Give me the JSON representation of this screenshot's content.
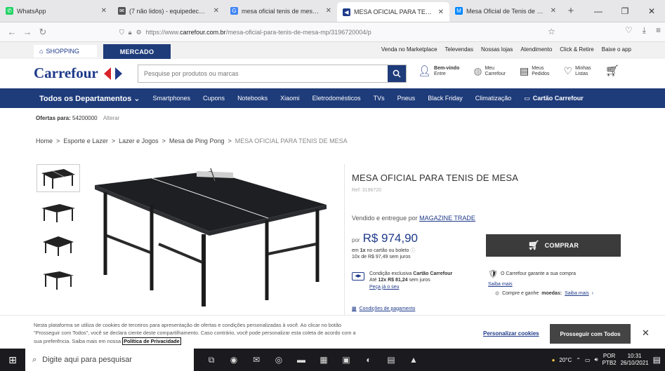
{
  "browser": {
    "tabs": [
      {
        "label": "WhatsApp",
        "favicon": "whatsapp-icon",
        "color": "#25d366"
      },
      {
        "label": "(7 não lidos) - equipedec@yah...",
        "favicon": "mail-icon",
        "color": "#555"
      },
      {
        "label": "mesa oficial tenis de mesa - Pe...",
        "favicon": "google-icon",
        "color": "#4285f4"
      },
      {
        "label": "MESA OFICIAL PARA TENIS DE ...",
        "favicon": "carrefour-icon",
        "color": "#1e3a8a"
      },
      {
        "label": "Mesa Oficial de Tenis de Mesa - ...",
        "favicon": "magalu-icon",
        "color": "#0086ff"
      }
    ],
    "url_prefix": "https://www.",
    "url_host": "carrefour.com.br",
    "url_path": "/mesa-oficial-para-tenis-de-mesa-mp/3196720004/p"
  },
  "header": {
    "shopping_tab": "SHOPPING",
    "mercado_tab": "MERCADO",
    "top_links": [
      "Venda no Marketplace",
      "Televendas",
      "Nossas lojas",
      "Atendimento",
      "Click & Retire",
      "Baixe o app"
    ],
    "logo": "Carrefour",
    "search_placeholder": "Pesquise por produtos ou marcas",
    "account_line1": "Bem-vindo",
    "account_line2": "Entre",
    "meu_line1": "Meu",
    "meu_line2": "Carrefour",
    "pedidos_line1": "Meus",
    "pedidos_line2": "Pedidos",
    "listas_line1": "Minhas",
    "listas_line2": "Listas"
  },
  "departments": {
    "first": "Todos os Departamentos",
    "items": [
      "Smartphones",
      "Cupons",
      "Notebooks",
      "Xiaomi",
      "Eletrodomésticos",
      "TVs",
      "Pneus",
      "Black Friday",
      "Climatização"
    ],
    "last": "Cartão Carrefour"
  },
  "ofertas": {
    "label": "Ofertas para:",
    "cep": "54200000",
    "alterar": "Alterar"
  },
  "breadcrumb": [
    "Home",
    "Esporte e Lazer",
    "Lazer e Jogos",
    "Mesa de Ping Pong",
    "MESA OFICIAL PARA TENIS DE MESA"
  ],
  "product": {
    "title": "MESA OFICIAL PARA TENIS DE MESA",
    "ref": "Ref: 3196720",
    "seller_prefix": "Vendido e entregue por",
    "seller": "MAGAZINE TRADE",
    "price_prefix": "por",
    "price": "R$ 974,90",
    "installment_line1_a": "em",
    "installment_line1_b": "1x",
    "installment_line1_c": "no cartão ou boleto",
    "installment_line2": "10x de R$ 97,49 sem juros",
    "card_line1_a": "Condição exclusiva",
    "card_line1_b": "Cartão Carrefour",
    "card_line2_a": "Até",
    "card_line2_b": "12x R$ 81,24",
    "card_line2_c": "sem juros",
    "card_link": "Peça já o seu",
    "payment_link": "Condições de pagamento",
    "buy_label": "COMPRAR",
    "guarantee": "O Carrefour garante a sua compra",
    "saiba_mais": "Saiba mais",
    "moedas_a": "Compre e ganhe",
    "moedas_b": "moedas:",
    "moedas_link": "Saiba mais"
  },
  "cookie": {
    "text": "Nesta plataforma se utiliza de cookies de terceiros para apresentação de ofertas e condições personalizadas à você. Ao clicar no botão \"Prosseguir com Todos\", você se declara ciente deste compartilhamento. Caso contrário, você pode personalizar esta coleta de acordo com a sua preferência. Saiba mais em nossa",
    "policy": "Política de Privacidade",
    "personalize": "Personalizar cookies",
    "proceed": "Prosseguir com Todos"
  },
  "taskbar": {
    "search": "Digite aqui para pesquisar",
    "temp": "20°C",
    "lang1": "POR",
    "lang2": "PTB2",
    "time": "10:31",
    "date": "26/10/2021"
  }
}
